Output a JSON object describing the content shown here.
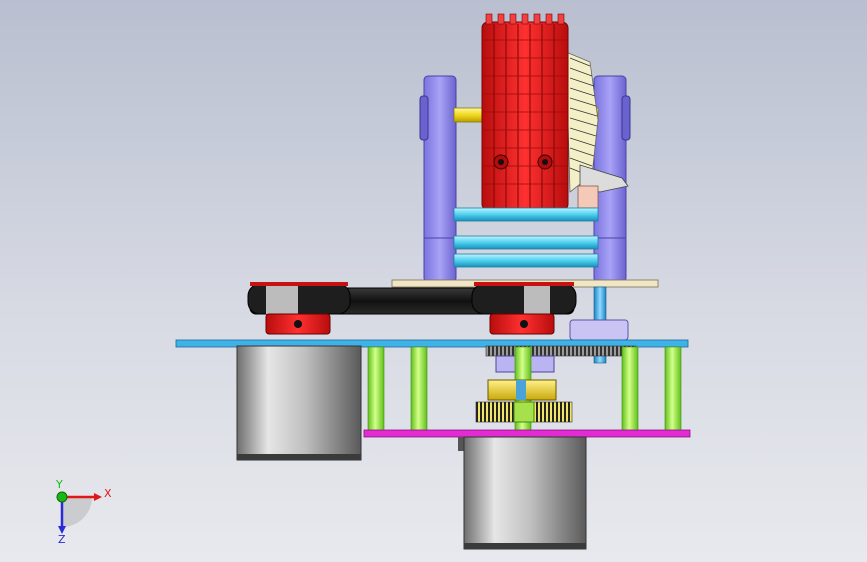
{
  "viewport": {
    "background_top": "#b9bfd0",
    "background_bottom": "#e8e9ee"
  },
  "colors": {
    "gear_red": "#e41616",
    "frame_purple": "#8f88ee",
    "shaft_yellow": "#f2e12a",
    "rod_cyan": "#58d8f0",
    "plate_cyan": "#3fb3e8",
    "plate_magenta": "#e22bd2",
    "pillar_green": "#9af03a",
    "belt_black": "#1b1b1b",
    "motor_grey": "#bdbdbd"
  },
  "triad": {
    "x_label": "X",
    "y_label": "Y",
    "z_label": "Z",
    "x_color": "#e01818",
    "y_color": "#18b818",
    "z_color": "#2a2ad8"
  }
}
